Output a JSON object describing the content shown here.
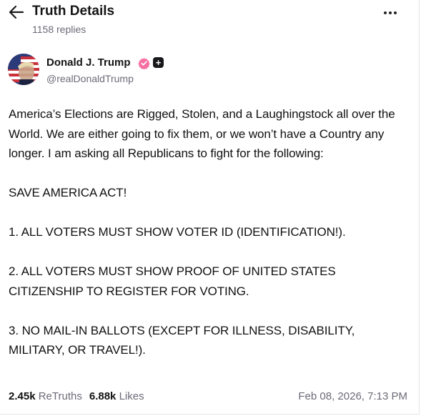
{
  "header": {
    "title": "Truth Details",
    "replies": "1158 replies",
    "back_icon": "arrow-left-icon",
    "more_icon": "more-dots-icon"
  },
  "author": {
    "name": "Donald J. Trump",
    "handle": "@realDonaldTrump",
    "verified_color": "#f56fa1",
    "badge_icon": "plus-square-icon"
  },
  "post": {
    "paragraphs": [
      "America’s Elections are Rigged, Stolen, and a Laughingstock all over the World. We are either going to fix them, or we won’t have a Country any longer. I am asking all Republicans to fight for the following:",
      "SAVE AMERICA ACT!",
      "1. ALL VOTERS MUST SHOW VOTER ID (IDENTIFICATION!).",
      "2. ALL VOTERS MUST SHOW PROOF OF UNITED STATES CITIZENSHIP TO REGISTER FOR VOTING.",
      "3. NO MAIL-IN BALLOTS (EXCEPT FOR ILLNESS, DISABILITY, MILITARY, OR TRAVEL!)."
    ]
  },
  "stats": {
    "retruths_count": "2.45k",
    "retruths_label": "ReTruths",
    "likes_count": "6.88k",
    "likes_label": "Likes",
    "timestamp": "Feb 08, 2026, 7:13 PM"
  },
  "colors": {
    "text": "#111111",
    "muted": "#6b6b78",
    "verified": "#f56fa1"
  }
}
